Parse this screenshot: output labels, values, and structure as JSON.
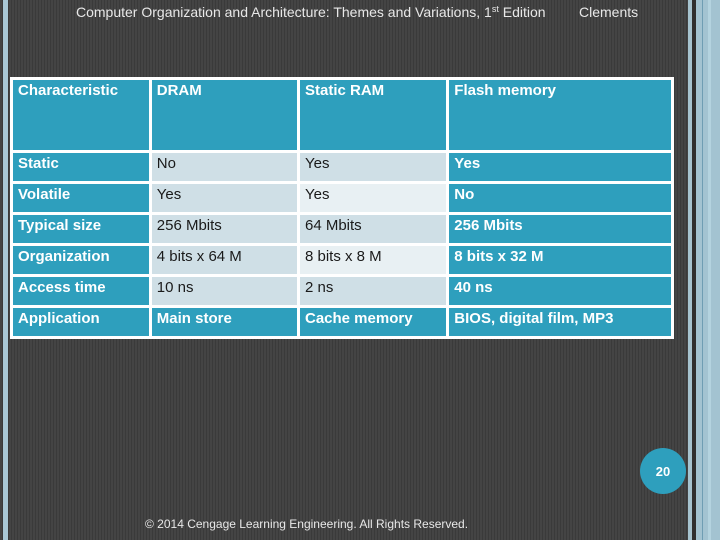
{
  "header": {
    "title": "Computer Organization and Architecture: Themes and Variations, 1",
    "title_superscript": "st",
    "title_suffix": " Edition",
    "author": "Clements"
  },
  "table": {
    "columns": [
      "Characteristic",
      "DRAM",
      "Static RAM",
      "Flash memory"
    ],
    "rows": [
      [
        "Static",
        "No",
        "Yes",
        "Yes"
      ],
      [
        "Volatile",
        "Yes",
        "Yes",
        "No"
      ],
      [
        "Typical size",
        "256 Mbits",
        "64 Mbits",
        "256 Mbits"
      ],
      [
        "Organization",
        "4 bits x 64 M",
        "8 bits x 8 M",
        "8 bits x 32 M"
      ],
      [
        "Access time",
        "10 ns",
        "2 ns",
        "40 ns"
      ],
      [
        "Application",
        "Main store",
        "Cache memory",
        "BIOS, digital film, MP3"
      ]
    ]
  },
  "colors": {
    "accent_teal": "#2e9fbd",
    "cell_light": "#cfdfe6",
    "cell_lighter": "#e8f0f3",
    "background": "#3f3f3f"
  },
  "page_number": "20",
  "footer": "© 2014 Cengage Learning Engineering. All Rights Reserved."
}
